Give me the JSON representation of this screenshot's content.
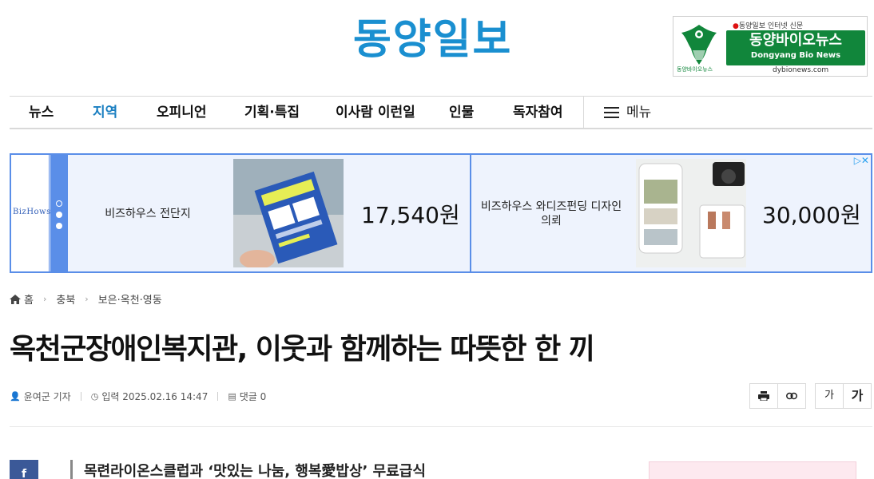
{
  "header": {
    "logo": "동양일보",
    "bio_banner": {
      "tagline": "동양일보 인터넷 신문",
      "title": "동양바이오뉴스",
      "subtitle": "Dongyang Bio News",
      "url": "dybionews.com",
      "small": "동양바이오뉴스"
    }
  },
  "nav": {
    "items": [
      "뉴스",
      "지역",
      "오피니언",
      "기획·특집",
      "이사람 이런일",
      "인물",
      "독자참여"
    ],
    "active": "지역",
    "menu_label": "메뉴"
  },
  "ad": {
    "brand": "BizHows",
    "items": [
      {
        "title": "비즈하우스 전단지",
        "price": "17,540원"
      },
      {
        "title": "비즈하우스 와디즈펀딩 디자인 의뢰",
        "price": "30,000원"
      }
    ],
    "badge": "▷✕"
  },
  "breadcrumb": [
    "홈",
    "충북",
    "보은·옥천·영동"
  ],
  "article": {
    "title": "옥천군장애인복지관, 이웃과 함께하는 따뜻한 한 끼",
    "author": "윤여군 기자",
    "date": "입력 2025.02.16 14:47",
    "comments": "댓글 0",
    "subhead": "목련라이온스클럽과 ‘맛있는 나눔, 행복愛밥상’ 무료급식"
  },
  "tools": {
    "font_small": "가",
    "font_large": "가"
  },
  "social": {
    "facebook": "f"
  }
}
